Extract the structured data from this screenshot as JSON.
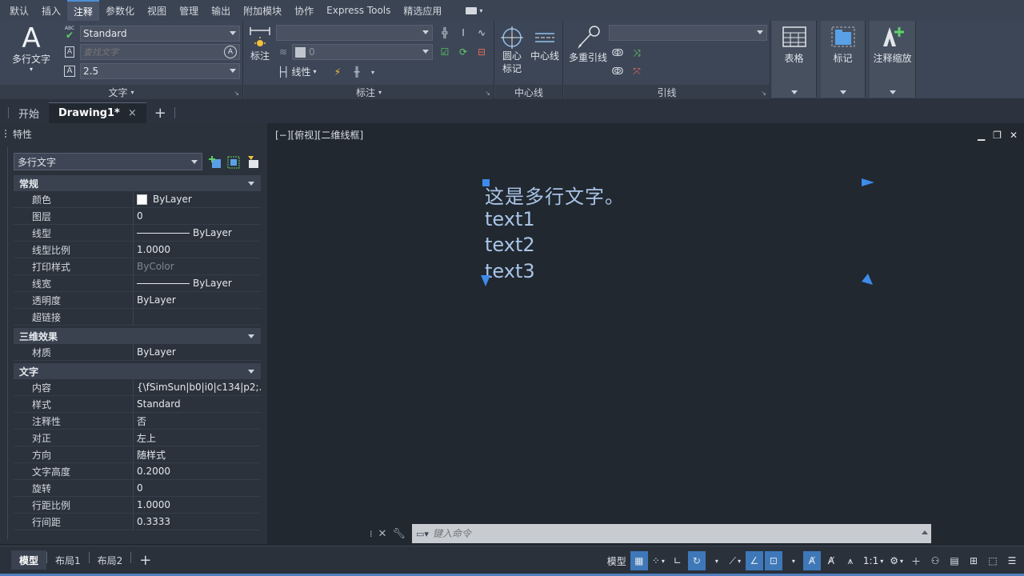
{
  "menu": {
    "tabs": [
      "默认",
      "插入",
      "注释",
      "参数化",
      "视图",
      "管理",
      "输出",
      "附加模块",
      "协作",
      "Express Tools",
      "精选应用"
    ],
    "active_index": 2
  },
  "ribbon": {
    "text_panel": {
      "title": "文字",
      "mtext_label": "多行文字",
      "style_value": "Standard",
      "find_placeholder": "查找文字",
      "height_value": "2.5",
      "abc_label": "ABC"
    },
    "dim_panel": {
      "title": "标注",
      "dim_label": "标注",
      "style_combo": "",
      "layer_combo": "0",
      "linetype_label": "线性"
    },
    "center_panel": {
      "title": "中心线",
      "center_mark_label": "圆心\n标记",
      "center_line_label": "中心线"
    },
    "leader_panel": {
      "title": "引线",
      "mleader_label": "多重引线",
      "style_combo": ""
    },
    "table_label": "表格",
    "markup_label": "标记",
    "annoscale_label": "注释缩放"
  },
  "file_tabs": {
    "start": "开始",
    "drawing": "Drawing1*",
    "close": "×",
    "plus": "+"
  },
  "properties": {
    "title": "特性",
    "object_type": "多行文字",
    "categories": [
      {
        "name": "常规",
        "rows": [
          {
            "key": "颜色",
            "value": "ByLayer"
          },
          {
            "key": "图层",
            "value": "0"
          },
          {
            "key": "线型",
            "value": "ByLayer"
          },
          {
            "key": "线型比例",
            "value": "1.0000"
          },
          {
            "key": "打印样式",
            "value": "ByColor"
          },
          {
            "key": "线宽",
            "value": "ByLayer"
          },
          {
            "key": "透明度",
            "value": "ByLayer"
          },
          {
            "key": "超链接",
            "value": ""
          }
        ]
      },
      {
        "name": "三维效果",
        "rows": [
          {
            "key": "材质",
            "value": "ByLayer"
          }
        ]
      },
      {
        "name": "文字",
        "rows": [
          {
            "key": "内容",
            "value": "{\\fSimSun|b0|i0|c134|p2;..."
          },
          {
            "key": "样式",
            "value": "Standard"
          },
          {
            "key": "注释性",
            "value": "否"
          },
          {
            "key": "对正",
            "value": "左上"
          },
          {
            "key": "方向",
            "value": "随样式"
          },
          {
            "key": "文字高度",
            "value": "0.2000"
          },
          {
            "key": "旋转",
            "value": "0"
          },
          {
            "key": "行距比例",
            "value": "1.0000"
          },
          {
            "key": "行间距",
            "value": "0.3333"
          }
        ]
      }
    ]
  },
  "viewport": {
    "label": "[−][俯视][二维线框]",
    "minimize": "▁",
    "restore": "❐",
    "close": "✕"
  },
  "mtext": {
    "lines": [
      "这是多行文字。",
      "text1",
      "text2",
      "text3"
    ],
    "color": "#a9c4e6",
    "grip_color": "#3d8bea"
  },
  "command": {
    "placeholder": "键入命令",
    "close": "✕"
  },
  "layout_tabs": [
    "模型",
    "布局1",
    "布局2"
  ],
  "status": {
    "model_label": "模型",
    "scale_label": "1:1"
  },
  "colors": {
    "accent": "#3e78b9",
    "canvas": "#212830"
  }
}
